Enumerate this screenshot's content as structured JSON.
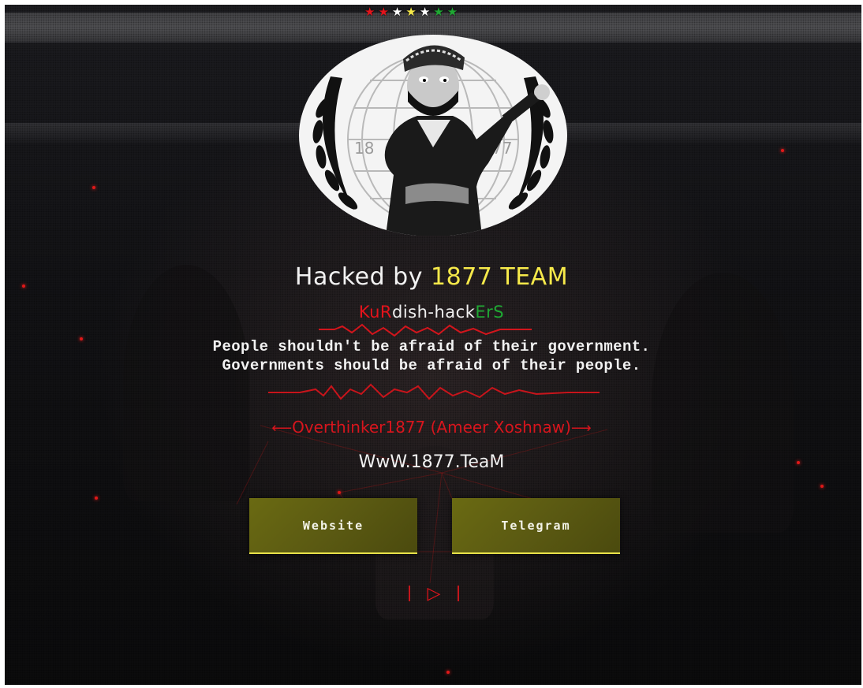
{
  "header": {
    "stars": [
      {
        "icon": "star-icon",
        "color": "#e3131b"
      },
      {
        "icon": "star-icon",
        "color": "#e3131b"
      },
      {
        "icon": "star-icon",
        "color": "#ffffff"
      },
      {
        "icon": "star-icon",
        "color": "#f6e94a"
      },
      {
        "icon": "star-icon",
        "color": "#ffffff"
      },
      {
        "icon": "star-icon",
        "color": "#1fa833"
      },
      {
        "icon": "star-icon",
        "color": "#1fa833"
      }
    ]
  },
  "logo": {
    "icon": "team-emblem-logo",
    "left_year": "18",
    "right_year": "77"
  },
  "main": {
    "title_prefix": "Hacked by ",
    "title_accent": "1877 TEAM",
    "subtitle_parts": {
      "red": "KuR",
      "white": "dish-hack",
      "green": "ErS"
    },
    "quote_line_1": "People shouldn't be afraid of their government.",
    "quote_line_2": "Governments should be afraid of their people.",
    "author": "Overthinker1877 (Ameer Xoshnaw)",
    "author_arrow_left": "⟵",
    "author_arrow_right": "⟶",
    "site": "WwW.1877.TeaM"
  },
  "buttons": {
    "website_label": "Website",
    "telegram_label": "Telegram"
  },
  "player": {
    "play_icon": "play-icon",
    "play_glyph": "▷"
  },
  "colors": {
    "accent_yellow": "#f6e94a",
    "red": "#e3131b",
    "green": "#1fa833",
    "button_bg": "#5b5a12"
  }
}
